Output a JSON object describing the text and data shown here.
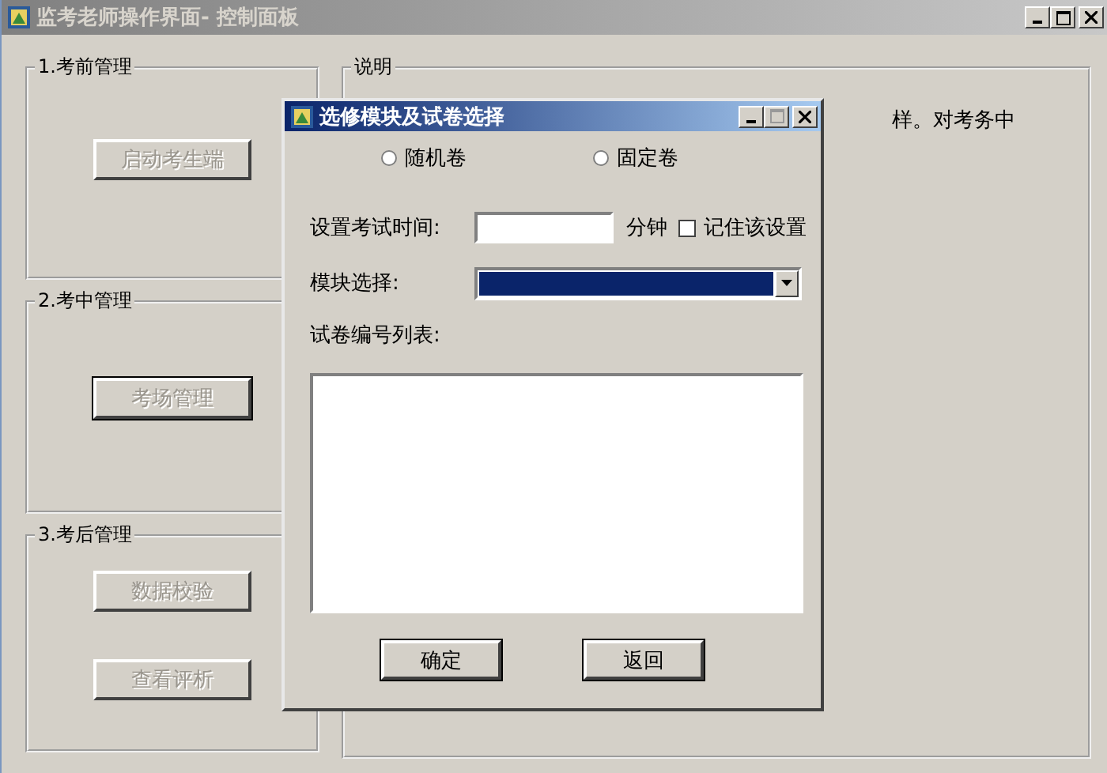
{
  "main_window": {
    "title": "监考老师操作界面- 控制面板",
    "groups": [
      {
        "title": "1.考前管理",
        "buttons": [
          {
            "label": "启动考生端",
            "disabled": true,
            "default": false
          }
        ]
      },
      {
        "title": "2.考中管理",
        "buttons": [
          {
            "label": "考场管理",
            "disabled": true,
            "default": true
          }
        ]
      },
      {
        "title": "3.考后管理",
        "buttons": [
          {
            "label": "数据校验",
            "disabled": true,
            "default": false
          },
          {
            "label": "查看评析",
            "disabled": true,
            "default": false
          }
        ]
      }
    ],
    "description": {
      "title": "说明",
      "text": "样。对考务中"
    }
  },
  "dialog": {
    "title": "选修模块及试卷选择",
    "radios": [
      {
        "label": "随机卷",
        "selected": false
      },
      {
        "label": "固定卷",
        "selected": false
      }
    ],
    "time_label": "设置考试时间:",
    "time_unit": "分钟",
    "remember": {
      "label": "记住该设置",
      "checked": false
    },
    "module_label": "模块选择:",
    "list_label": "试卷编号列表:",
    "buttons": [
      {
        "label": "确定",
        "default": true
      },
      {
        "label": "返回",
        "default": true
      }
    ]
  }
}
